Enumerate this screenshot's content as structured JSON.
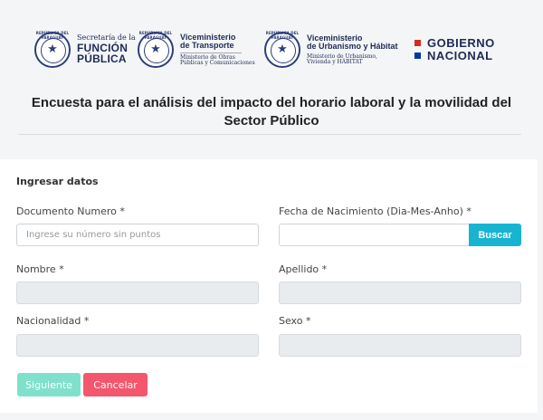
{
  "logos": {
    "seal_text": "REPÚBLICA DEL PARAGUAY",
    "funcion_publica": {
      "line1": "Secretaría de la",
      "line2": "FUNCIÓN",
      "line3": "PÚBLICA"
    },
    "transporte": {
      "line1": "Viceministerio",
      "line2": "de Transporte",
      "sub1": "Ministerio de Obras",
      "sub2": "Públicas y Comunicaciones"
    },
    "urbanismo": {
      "line1": "Viceministerio",
      "line2": "de Urbanismo y Hábitat",
      "sub1": "Ministerio de Urbanismo,",
      "sub2": "Vivienda y HÁBITAT"
    },
    "gobierno": {
      "line1": "GOBIERNO",
      "line2": "NACIONAL"
    }
  },
  "title": "Encuesta para el análisis del impacto del horario laboral y la movilidad del Sector Público",
  "form": {
    "section_title": "Ingresar datos",
    "documento_label": "Documento Numero *",
    "documento_placeholder": "Ingrese su número sin puntos",
    "nacimiento_label": "Fecha de Nacimiento (Dia-Mes-Anho) *",
    "buscar_label": "Buscar",
    "nombre_label": "Nombre *",
    "apellido_label": "Apellido *",
    "nacionalidad_label": "Nacionalidad *",
    "sexo_label": "Sexo *",
    "siguiente_label": "Siguiente",
    "cancelar_label": "Cancelar"
  },
  "colors": {
    "primary_blue": "#1f2a55",
    "buscar": "#17b4d2",
    "siguiente": "#7fe0cc",
    "cancelar": "#f4566e",
    "flag_red": "#d52b1e",
    "flag_blue": "#0038a8"
  }
}
